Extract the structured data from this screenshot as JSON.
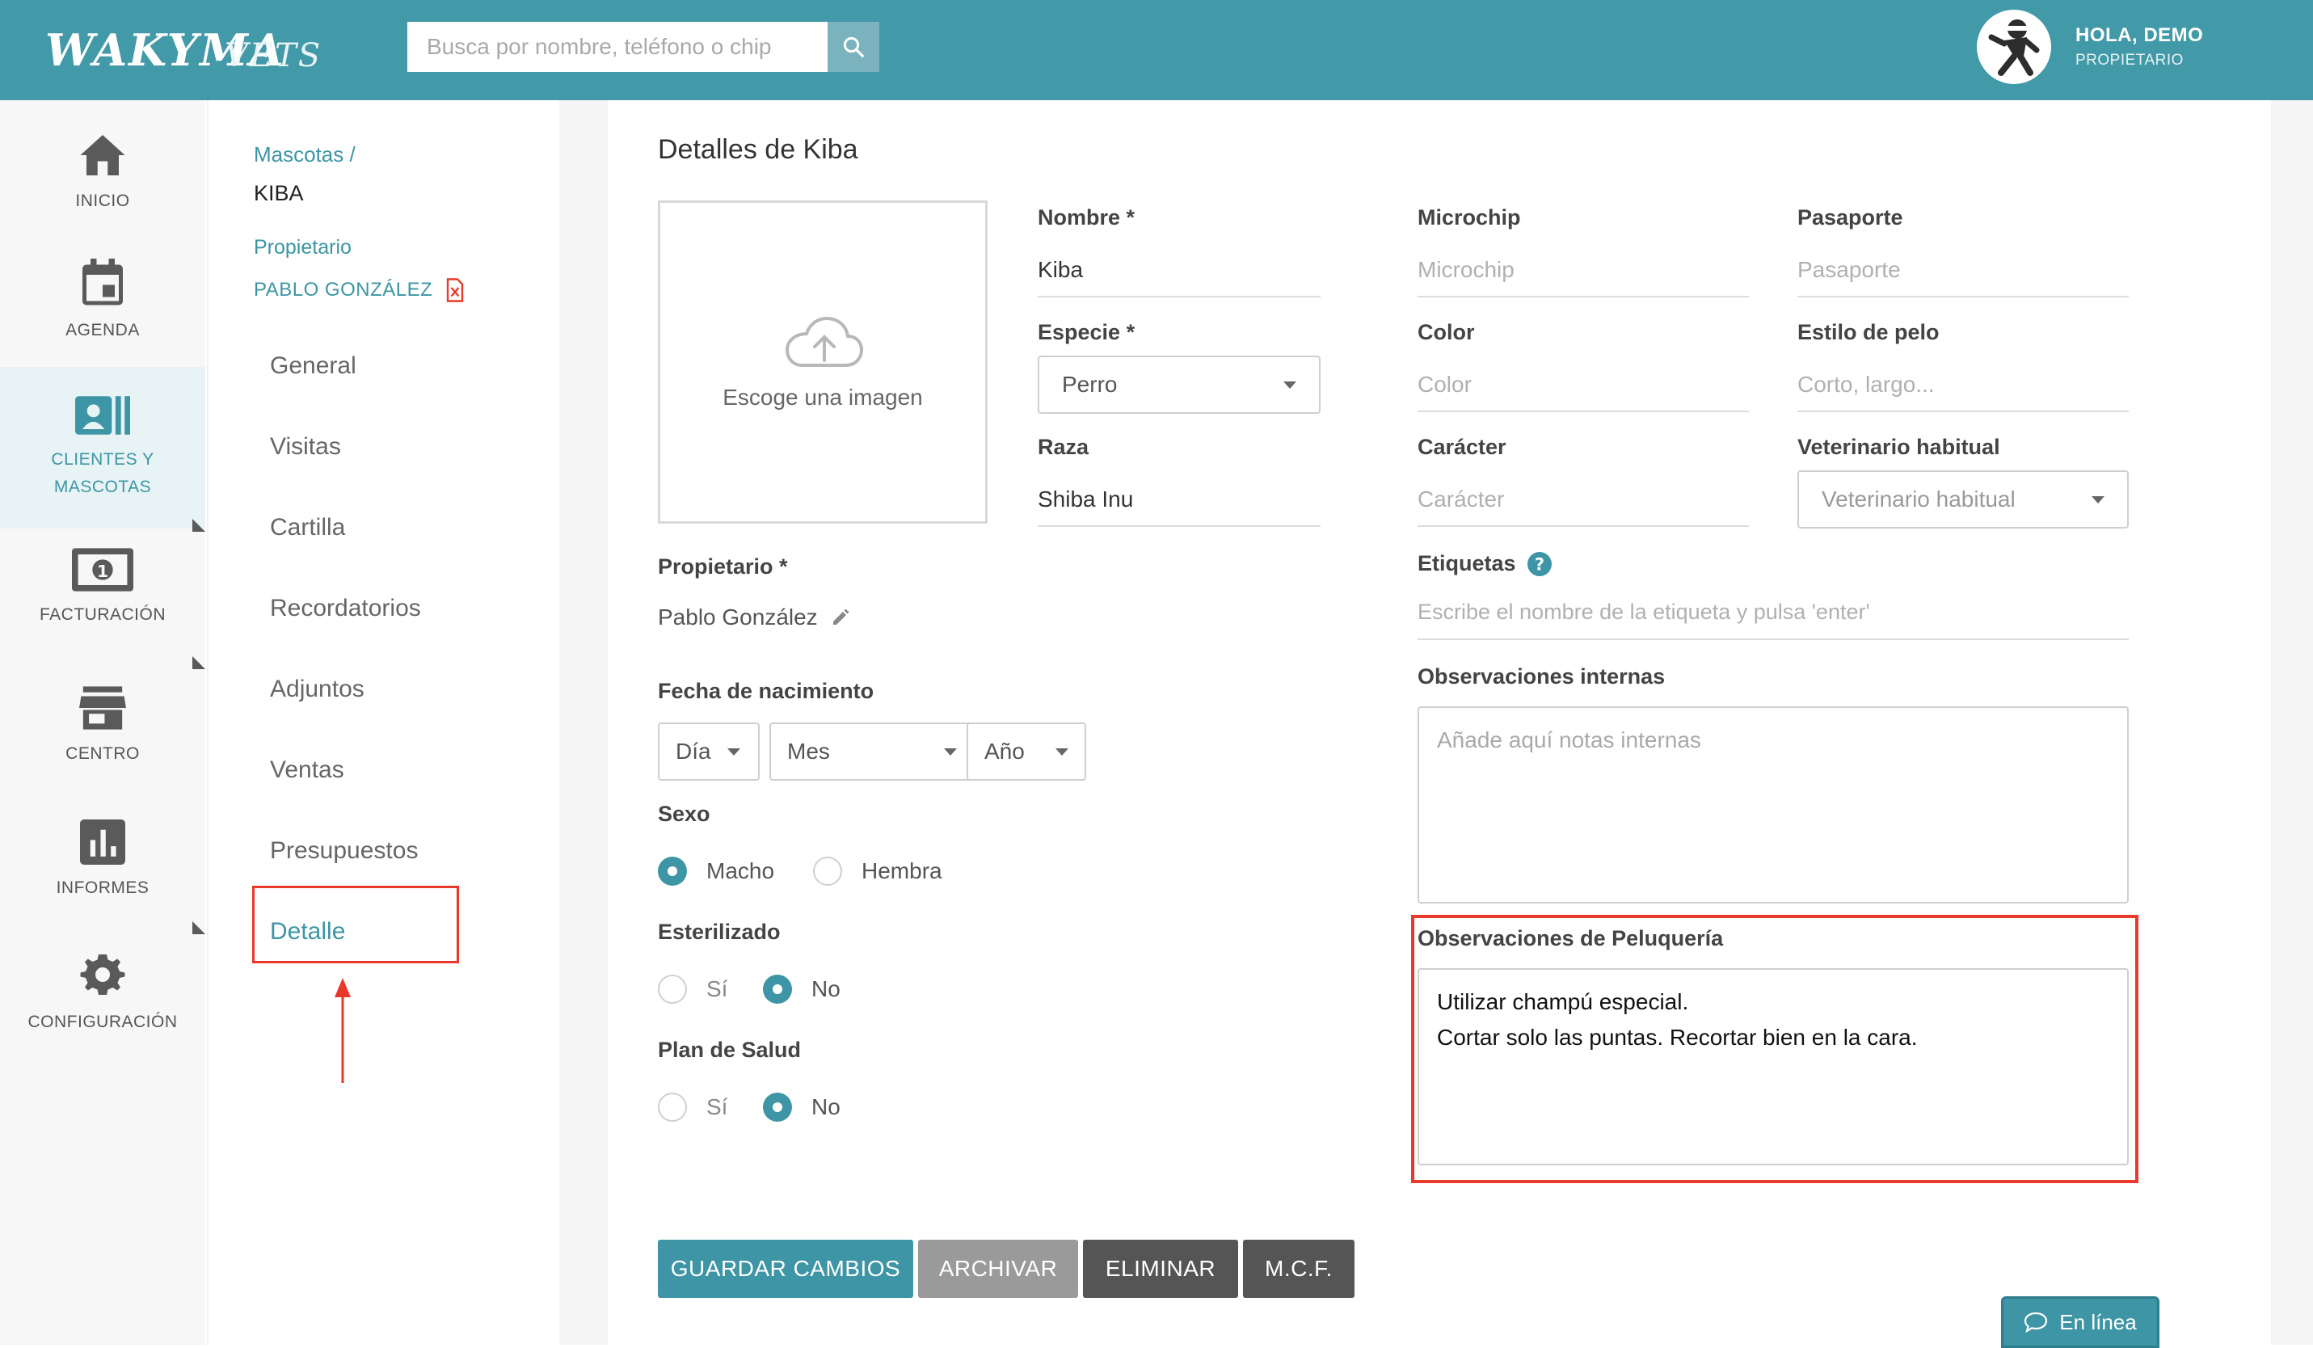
{
  "header": {
    "logo": "WAKYMA",
    "logo_sub": "VETS",
    "search_placeholder": "Busca por nombre, teléfono o chip",
    "greeting": "HOLA, DEMO",
    "role": "PROPIETARIO"
  },
  "nav": {
    "inicio": "INICIO",
    "agenda": "AGENDA",
    "clientes_line1": "CLIENTES Y",
    "clientes_line2": "MASCOTAS",
    "facturacion": "FACTURACIÓN",
    "centro": "CENTRO",
    "informes": "INFORMES",
    "configuracion": "CONFIGURACIÓN"
  },
  "subnav": {
    "breadcrumb_link": "Mascotas /",
    "breadcrumb_current": "KIBA",
    "owner_label": "Propietario",
    "owner_name": "PABLO GONZÁLEZ",
    "items": [
      "General",
      "Visitas",
      "Cartilla",
      "Recordatorios",
      "Adjuntos",
      "Ventas",
      "Presupuestos",
      "Detalle"
    ]
  },
  "form": {
    "title": "Detalles de Kiba",
    "image_text": "Escoge una imagen",
    "nombre_label": "Nombre *",
    "nombre_value": "Kiba",
    "especie_label": "Especie *",
    "especie_value": "Perro",
    "raza_label": "Raza",
    "raza_value": "Shiba Inu",
    "microchip_label": "Microchip",
    "microchip_ph": "Microchip",
    "pasaporte_label": "Pasaporte",
    "pasaporte_ph": "Pasaporte",
    "color_label": "Color",
    "color_ph": "Color",
    "estilo_label": "Estilo de pelo",
    "estilo_ph": "Corto, largo...",
    "caracter_label": "Carácter",
    "caracter_ph": "Carácter",
    "vet_label": "Veterinario habitual",
    "vet_ph": "Veterinario habitual",
    "propietario_label": "Propietario *",
    "propietario_value": "Pablo González",
    "etiquetas_label": "Etiquetas",
    "etiquetas_ph": "Escribe el nombre de la etiqueta y pulsa 'enter'",
    "fecha_label": "Fecha de nacimiento",
    "dia": "Día",
    "mes": "Mes",
    "anio": "Año",
    "sexo_label": "Sexo",
    "macho": "Macho",
    "hembra": "Hembra",
    "esterilizado_label": "Esterilizado",
    "plan_label": "Plan de Salud",
    "si": "Sí",
    "no": "No",
    "obs_internas_label": "Observaciones internas",
    "obs_internas_ph": "Añade aquí notas internas",
    "obs_peluq_label": "Observaciones de Peluquería",
    "obs_peluq_value": "Utilizar champú especial.\nCortar solo las puntas. Recortar bien en la cara."
  },
  "buttons": {
    "guardar": "GUARDAR CAMBIOS",
    "archivar": "ARCHIVAR",
    "eliminar": "ELIMINAR",
    "mcf": "M.C.F."
  },
  "chat": {
    "label": "En línea"
  },
  "colors": {
    "brand": "#4299a8",
    "accent": "#3d95a5",
    "highlight": "#e8392a"
  }
}
